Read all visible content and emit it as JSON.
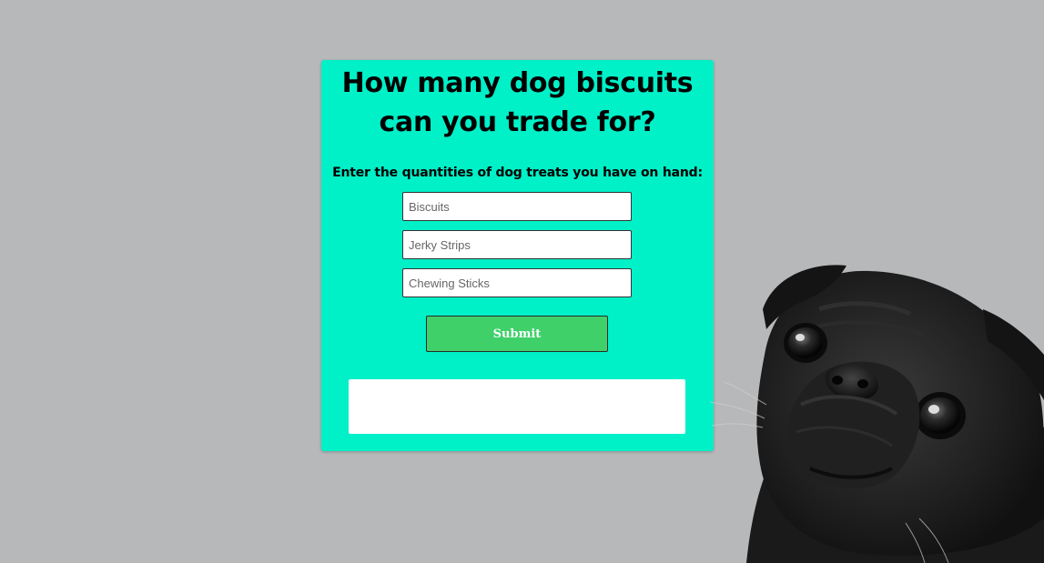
{
  "card": {
    "title": "How many dog biscuits can you trade for?",
    "instructions": "Enter the quantities of dog treats you have on hand:"
  },
  "form": {
    "biscuits_placeholder": "Biscuits",
    "jerky_placeholder": "Jerky Strips",
    "chewing_placeholder": "Chewing Sticks",
    "submit_label": "Submit"
  },
  "result": {
    "text": ""
  },
  "colors": {
    "background": "#b7b8ba",
    "card": "#00f0c8",
    "submit": "#3fd06a"
  },
  "images": {
    "dog": "pug-photo"
  }
}
